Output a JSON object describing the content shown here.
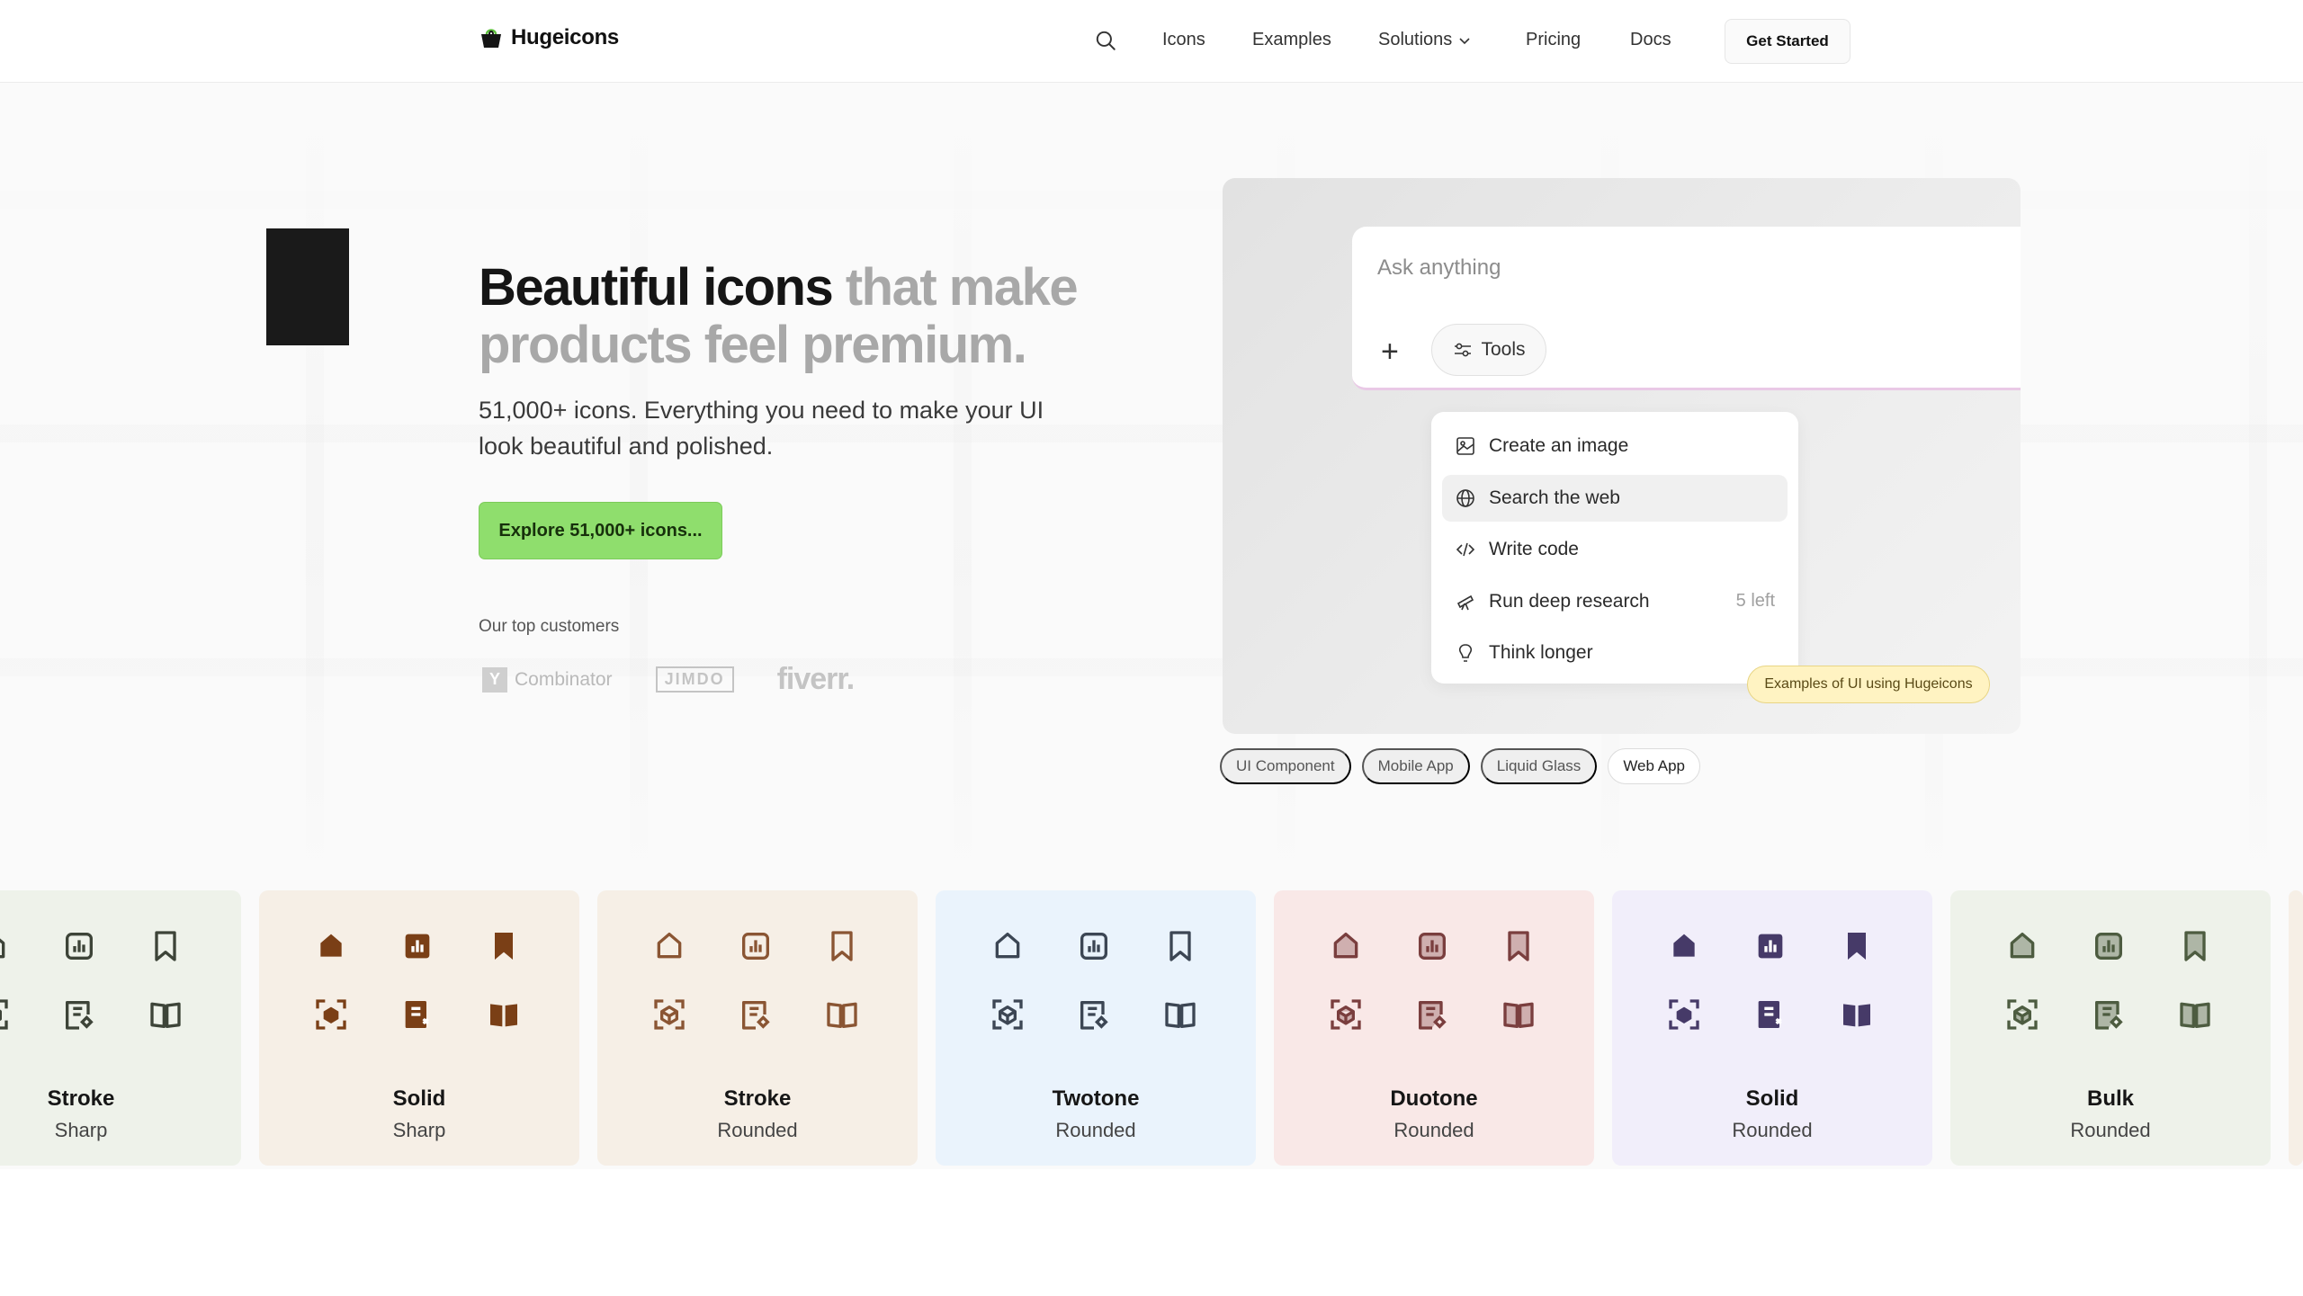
{
  "nav": {
    "brand": "Hugeicons",
    "links": [
      "Icons",
      "Examples",
      "Solutions",
      "Pricing",
      "Docs"
    ],
    "cta": "Get Started"
  },
  "hero": {
    "title_main": "Beautiful icons",
    "title_muted": "that make products feel premium.",
    "subtitle": "51,000+ icons. Everything you need to make your UI look beautiful and polished.",
    "cta": "Explore 51,000+ icons...",
    "customers_label": "Our top customers",
    "customers": {
      "yc_mark": "Y",
      "yc_text": "Combinator",
      "jimdo": "JIMDO",
      "fiverr": "fiverr."
    }
  },
  "demo": {
    "ask_placeholder": "Ask anything",
    "tools_label": "Tools",
    "menu": [
      {
        "label": "Create an image",
        "icon": "image-icon",
        "trail": ""
      },
      {
        "label": "Search the web",
        "icon": "globe-icon",
        "trail": "",
        "active": true
      },
      {
        "label": "Write code",
        "icon": "code-icon",
        "trail": ""
      },
      {
        "label": "Run deep research",
        "icon": "telescope-icon",
        "trail": "5 left"
      },
      {
        "label": "Think longer",
        "icon": "lightbulb-icon",
        "trail": ""
      }
    ],
    "badge": "Examples of UI using Hugeicons",
    "tabs": [
      "UI Component",
      "Mobile App",
      "Liquid Glass",
      "Web App"
    ],
    "selected_tab": "Web App"
  },
  "styles": [
    {
      "title": "Stroke",
      "sub": "Sharp",
      "bg": "#eef2ea",
      "color": "#3d4438",
      "variant": "stroke"
    },
    {
      "title": "Solid",
      "sub": "Sharp",
      "bg": "#f6efe6",
      "color": "#7a3f16",
      "variant": "solid"
    },
    {
      "title": "Stroke",
      "sub": "Rounded",
      "bg": "#f6efe6",
      "color": "#8a5533",
      "variant": "stroke"
    },
    {
      "title": "Twotone",
      "sub": "Rounded",
      "bg": "#eaf3fc",
      "color": "#3c4654",
      "variant": "twotone"
    },
    {
      "title": "Duotone",
      "sub": "Rounded",
      "bg": "#f9e8e7",
      "color": "#7a3e3e",
      "variant": "duotone"
    },
    {
      "title": "Solid",
      "sub": "Rounded",
      "bg": "#f1eefa",
      "color": "#463a68",
      "variant": "solid"
    },
    {
      "title": "Bulk",
      "sub": "Rounded",
      "bg": "#eef2ea",
      "color": "#4d5c40",
      "variant": "bulk"
    }
  ]
}
